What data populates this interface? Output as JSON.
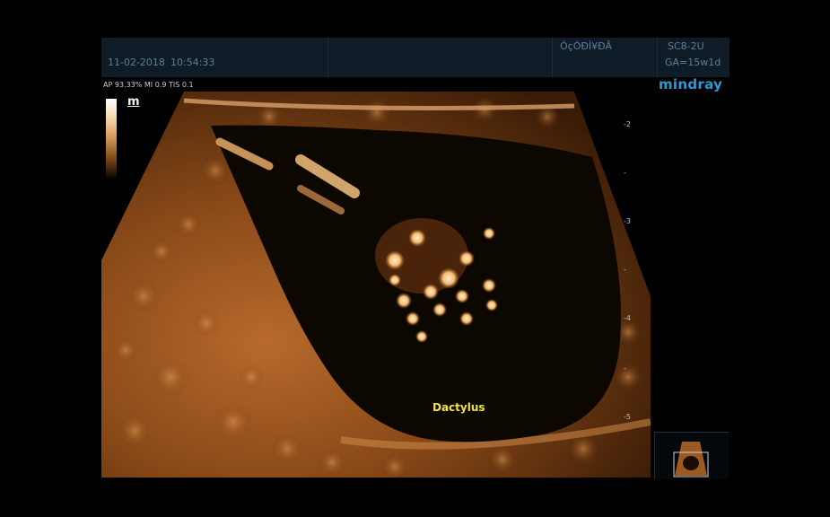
{
  "header": {
    "date": "11-02-2018",
    "time": "10:54:33",
    "hospital_name": "ÓçÓÐÍ¥ÐÂ",
    "probe": "SC8-2U",
    "gestational_age": "GA=15w1d"
  },
  "params": "AP 93.33%  MI 0.9 TIS 0.1",
  "brand": "mindray",
  "grayscale_icon": "m",
  "annotation": "Dactylus",
  "depth_scale": [
    {
      "label": "-2"
    },
    {
      "label": "-"
    },
    {
      "label": "-3"
    },
    {
      "label": "-"
    },
    {
      "label": "-4"
    },
    {
      "label": "-"
    },
    {
      "label": "-5"
    }
  ],
  "colors": {
    "header_bg": "#0f1b26",
    "header_text": "#5f7f9a",
    "tissue": "#c8783a",
    "annotation": "#f0e63a",
    "brand": "#2a9ad8"
  }
}
